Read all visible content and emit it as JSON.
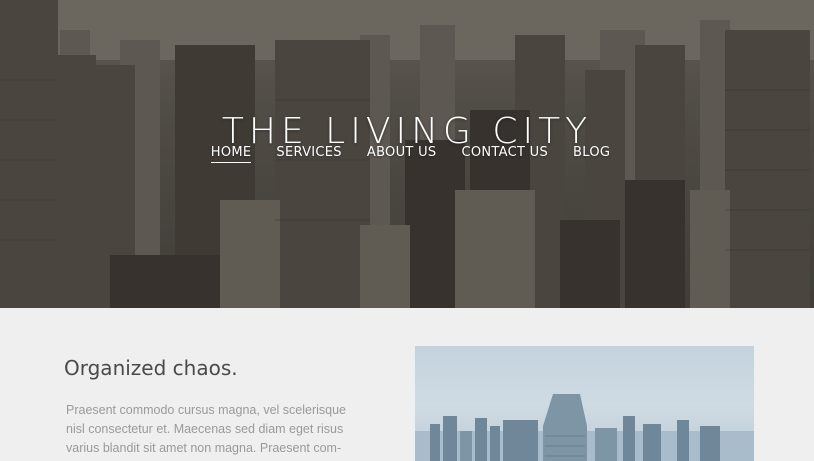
{
  "hero": {
    "title": "THE LIVING CITY",
    "nav": [
      {
        "label": "HOME",
        "active": true
      },
      {
        "label": "SERVICES",
        "active": false
      },
      {
        "label": "ABOUT US",
        "active": false
      },
      {
        "label": "CONTACT US",
        "active": false
      },
      {
        "label": "BLOG",
        "active": false
      }
    ]
  },
  "content": {
    "heading": "Organized chaos.",
    "paragraph": "Praesent commodo cursus magna, vel scelerisque nisl consectetur et. Maecenas sed diam eget risus varius blandit sit amet non magna. Praesent com-modo cursus magna, vel scelerisque nisl consecte"
  },
  "colors": {
    "page_background": "#efefef",
    "heading": "#4a4a4a",
    "body_text": "#9a9a9a",
    "nav_text": "#ffffff"
  }
}
